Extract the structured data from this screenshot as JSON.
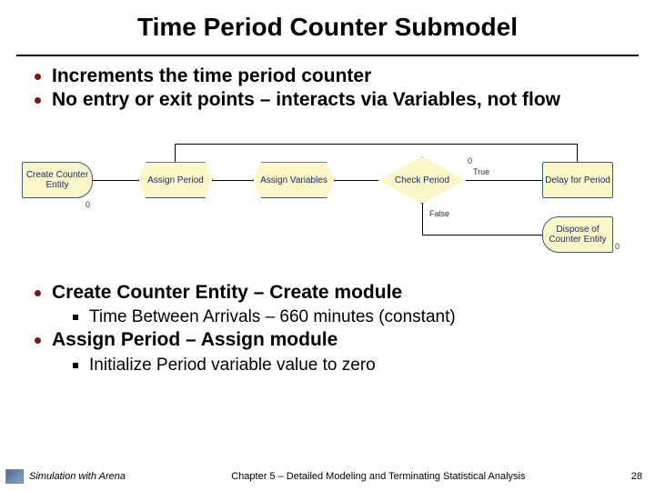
{
  "title": "Time Period Counter Submodel",
  "top_bullets": [
    "Increments the time period counter",
    "No entry or exit points – interacts via Variables, not flow"
  ],
  "diagram": {
    "create": "Create Counter Entity",
    "assign1": "Assign Period",
    "assign2": "Assign Variables",
    "decide": "Check Period",
    "delay": "Delay for Period",
    "dispose": "Dispose of Counter Entity",
    "true_label": "True",
    "false_label": "False",
    "zero1": "0",
    "zero2": "0",
    "zero3": "0"
  },
  "bottom": {
    "h1": "Create Counter Entity – Create module",
    "s1": "Time Between Arrivals – 660 minutes (constant)",
    "h2": "Assign Period – Assign module",
    "s2": "Initialize Period variable value to zero"
  },
  "footer": {
    "left": "Simulation with Arena",
    "center": "Chapter 5 – Detailed Modeling and Terminating Statistical Analysis",
    "right": "28"
  }
}
